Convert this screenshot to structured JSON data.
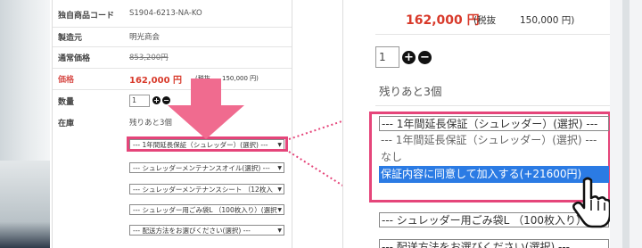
{
  "left_panel": {
    "product_code": {
      "label": "独自商品コード",
      "value": "S1904-6213-NA-KO"
    },
    "maker": {
      "label": "製造元",
      "value": "明光商会"
    },
    "regular_price": {
      "label": "通常価格",
      "value": "853,200円"
    },
    "price": {
      "label": "価格",
      "value": "162,000 円",
      "tax_label": "(税抜",
      "tax_value": "150,000 円)"
    },
    "quantity": {
      "label": "数量",
      "value": "1",
      "plus": "+",
      "minus": "−"
    },
    "stock": {
      "label": "在庫",
      "value": "残りあと3個"
    },
    "selects": [
      "--- 1年間延長保証（シュレッダー）(選択) ---",
      "--- シュレッダーメンテナンスオイル(選択) ---",
      "--- シュレッダーメンテナンスシート （12枚入",
      "--- シュレッダー用ごみ袋L （100枚入り）(選択",
      "--- 配送方法をお選びください(選択) ---"
    ]
  },
  "right_panel": {
    "price": "162,000 円",
    "tax_label": "(税抜",
    "tax_value": "150,000 円)",
    "quantity": "1",
    "plus": "+",
    "minus": "−",
    "stock": "残りあと3個",
    "warranty_select": "--- 1年間延長保証（シュレッダー）(選択) ---",
    "options": [
      "--- 1年間延長保証（シュレッダー）(選択) ---",
      "なし",
      "保証内容に同意して加入する(+21600円)"
    ],
    "active_option_index": 2,
    "next_select": "--- シュレッダー用ごみ袋L （100枚入り）",
    "next_select_partial": "--- 配送方法をお選びください(選択) ---"
  },
  "colors": {
    "highlight": "#e5457a",
    "price_red": "#d83a2b",
    "option_active": "#2b7be4"
  },
  "icons": [
    "down-arrow-icon",
    "pointer-hand-icon",
    "select-caret-icon"
  ]
}
